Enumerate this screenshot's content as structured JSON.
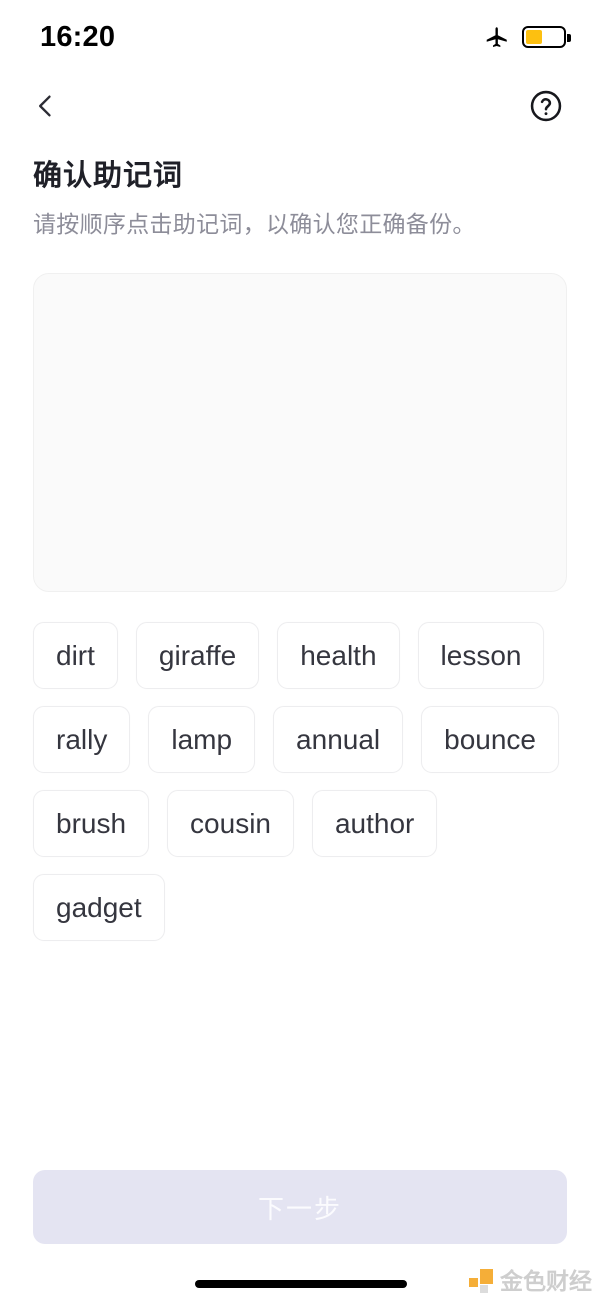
{
  "status_bar": {
    "time": "16:20",
    "airplane_icon": "airplane-mode-icon",
    "battery_icon": "battery-icon",
    "battery_level_percent": 45,
    "battery_color": "#fdc010"
  },
  "nav_bar": {
    "back_icon": "chevron-left-icon",
    "help_icon": "question-mark-circle-icon"
  },
  "page": {
    "title": "确认助记词",
    "subtitle": "请按顺序点击助记词，以确认您正确备份。"
  },
  "answer_area": {
    "selected_words": [],
    "placeholder": ""
  },
  "word_pool": {
    "words": [
      "dirt",
      "giraffe",
      "health",
      "lesson",
      "rally",
      "lamp",
      "annual",
      "bounce",
      "brush",
      "cousin",
      "author",
      "gadget"
    ]
  },
  "footer": {
    "next_label": "下一步",
    "next_enabled": false,
    "next_bg_color": "#e4e4f2",
    "next_text_color": "#fbfbfe"
  },
  "watermark": {
    "text": "金色财经",
    "logo_color": "#f5a623"
  }
}
